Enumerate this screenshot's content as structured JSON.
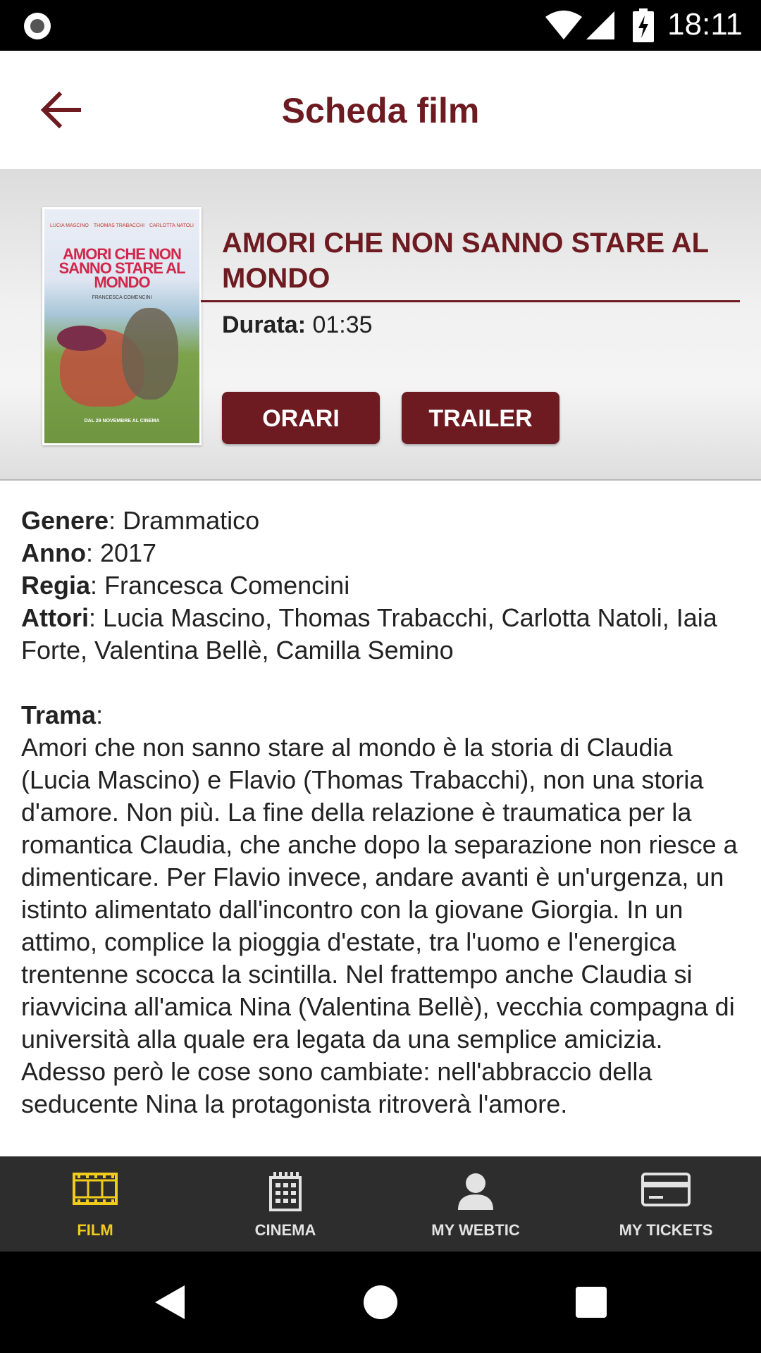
{
  "status_bar": {
    "time": "18:11"
  },
  "app_bar": {
    "title": "Scheda film"
  },
  "movie": {
    "title": "AMORI CHE NON SANNO STARE AL MONDO",
    "duration_label": "Durata:",
    "duration_value": "01:35",
    "poster": {
      "credits": [
        "LUCIA MASCINO",
        "THOMAS TRABACCHI",
        "CARLOTTA NATOLI"
      ],
      "title": "AMORI CHE NON SANNO STARE AL MONDO",
      "director": "FRANCESCA COMENCINI",
      "release": "DAL 29 NOVEMBRE AL CINEMA"
    },
    "buttons": {
      "schedule": "ORARI",
      "trailer": "TRAILER"
    }
  },
  "details": {
    "genre_label": "Genere",
    "genre": "Drammatico",
    "year_label": "Anno",
    "year": "2017",
    "director_label": "Regia",
    "director": "Francesca Comencini",
    "actors_label": "Attori",
    "actors": "Lucia Mascino, Thomas Trabacchi, Carlotta Natoli, Iaia Forte, Valentina Bellè, Camilla Semino",
    "plot_label": "Trama",
    "plot": "Amori che non sanno stare al mondo è la storia di Claudia (Lucia Mascino) e Flavio (Thomas Trabacchi), non una storia d'amore. Non più. La fine della relazione è traumatica per la romantica Claudia, che anche dopo la separazione non riesce a dimenticare. Per Flavio invece, andare avanti è un'urgenza, un istinto alimentato dall'incontro con la giovane Giorgia. In un attimo, complice la pioggia d'estate, tra l'uomo e l'energica trentenne scocca la scintilla. Nel frattempo anche Claudia si riavvicina all'amica Nina (Valentina Bellè), vecchia compagna di università alla quale era legata da una semplice amicizia. Adesso però le cose sono cambiate: nell'abbraccio della seducente Nina la protagonista ritroverà l'amore."
  },
  "bottom_nav": {
    "items": [
      {
        "label": "FILM",
        "icon": "film-icon",
        "active": true
      },
      {
        "label": "CINEMA",
        "icon": "building-icon",
        "active": false
      },
      {
        "label": "MY WEBTIC",
        "icon": "user-icon",
        "active": false
      },
      {
        "label": "MY TICKETS",
        "icon": "card-icon",
        "active": false
      }
    ]
  },
  "colors": {
    "brand": "#6d1a20",
    "nav_background": "#2d2d2d",
    "nav_active": "#f1cc1c"
  }
}
